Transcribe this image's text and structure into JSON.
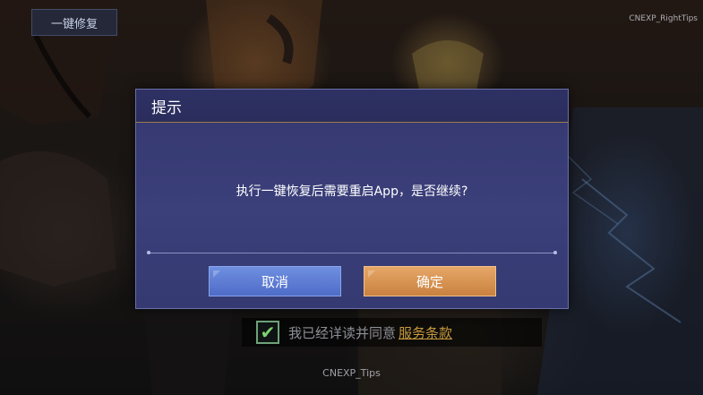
{
  "top_bar": {
    "restore_button_label": "一键修复",
    "right_tips": "CNEXP_RightTips"
  },
  "dialog": {
    "title": "提示",
    "message": "执行一键恢复后需要重启App，是否继续?",
    "cancel_label": "取消",
    "confirm_label": "确定"
  },
  "agreement": {
    "checked": true,
    "check_glyph": "✔",
    "text": "我已经详读并同意",
    "terms_link": "服务条款"
  },
  "bottom_tips": "CNEXP_Tips",
  "colors": {
    "dialog_bg": "#3b3f7a",
    "cancel_button": "#5a78d3",
    "confirm_button": "#d8944f",
    "terms_link": "#c69a3d"
  }
}
